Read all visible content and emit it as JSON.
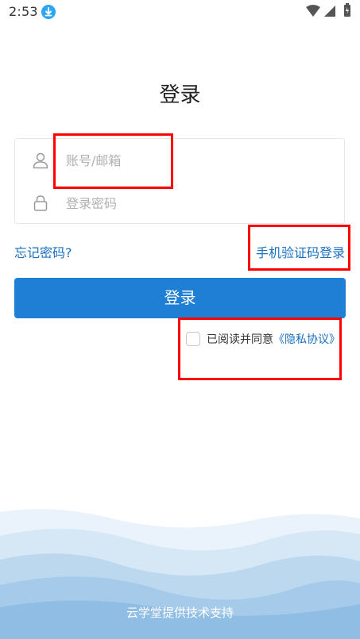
{
  "status_bar": {
    "time": "2:53",
    "icons": [
      "download-icon",
      "wifi-icon",
      "signal-icon",
      "battery-icon"
    ]
  },
  "page": {
    "title": "登录"
  },
  "form": {
    "account_placeholder": "账号/邮箱",
    "password_placeholder": "登录密码",
    "account_icon": "user-icon",
    "password_icon": "lock-icon"
  },
  "links": {
    "forgot_password": "忘记密码?",
    "sms_login": "手机验证码登录"
  },
  "login_button": {
    "label": "登录"
  },
  "agreement": {
    "text": "已阅读并同意",
    "link": "《隐私协议》",
    "checked": false
  },
  "footer": {
    "text": "云学堂提供技术支持"
  },
  "colors": {
    "accent": "#1e7fd4",
    "link": "#1a6fc0",
    "annotation": "#ff0000",
    "wave_light": "#e4eff9",
    "wave_mid": "#bcd8ef",
    "wave_dark": "#8fbde4"
  }
}
